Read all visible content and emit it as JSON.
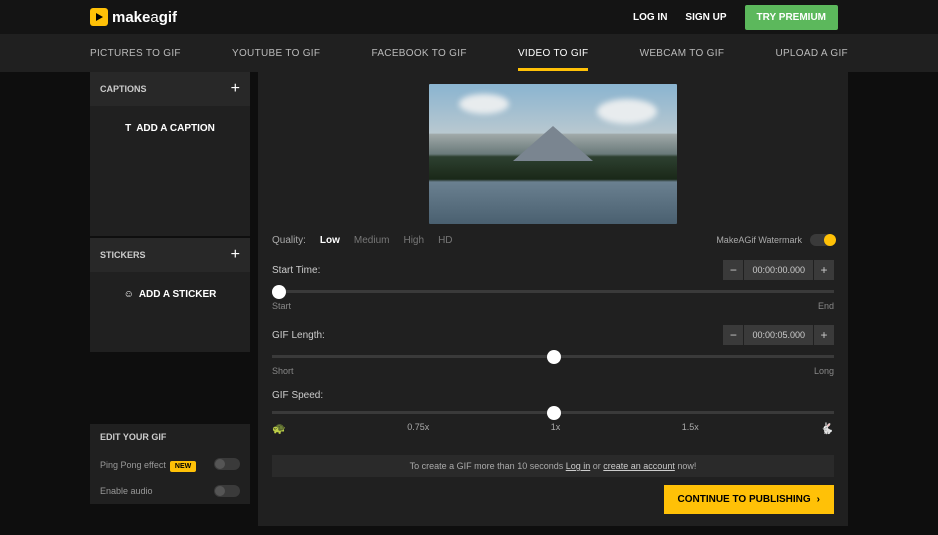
{
  "header": {
    "logo_make": "make",
    "logo_a": "a",
    "logo_gif": "gif",
    "login": "LOG IN",
    "signup": "SIGN UP",
    "premium": "TRY PREMIUM"
  },
  "nav": {
    "tabs": [
      "PICTURES TO GIF",
      "YOUTUBE TO GIF",
      "FACEBOOK TO GIF",
      "VIDEO TO GIF",
      "WEBCAM TO GIF",
      "UPLOAD A GIF"
    ],
    "active_index": 3
  },
  "sidebar": {
    "captions": {
      "title": "CAPTIONS",
      "add_label": "ADD A CAPTION"
    },
    "stickers": {
      "title": "STICKERS",
      "add_label": "ADD A STICKER"
    },
    "edit": {
      "title": "EDIT YOUR GIF",
      "pingpong_label": "Ping Pong effect",
      "new_badge": "NEW",
      "audio_label": "Enable audio"
    }
  },
  "quality": {
    "label": "Quality:",
    "options": [
      "Low",
      "Medium",
      "High",
      "HD"
    ],
    "active_index": 0,
    "watermark_label": "MakeAGif Watermark"
  },
  "starttime": {
    "label": "Start Time:",
    "value": "00:00:00.000",
    "left": "Start",
    "right": "End",
    "thumb_pos": "0%"
  },
  "giflength": {
    "label": "GIF Length:",
    "value": "00:00:05.000",
    "left": "Short",
    "right": "Long",
    "thumb_pos": "49%"
  },
  "gifspeed": {
    "label": "GIF Speed:",
    "ticks": [
      "0.75x",
      "1x",
      "1.5x"
    ],
    "thumb_pos": "49%"
  },
  "notice": {
    "prefix": "To create a GIF more than 10 seconds ",
    "login": "Log in",
    "or": " or ",
    "create": "create an account",
    "suffix": " now!"
  },
  "footer": {
    "continue": "CONTINUE TO PUBLISHING"
  }
}
